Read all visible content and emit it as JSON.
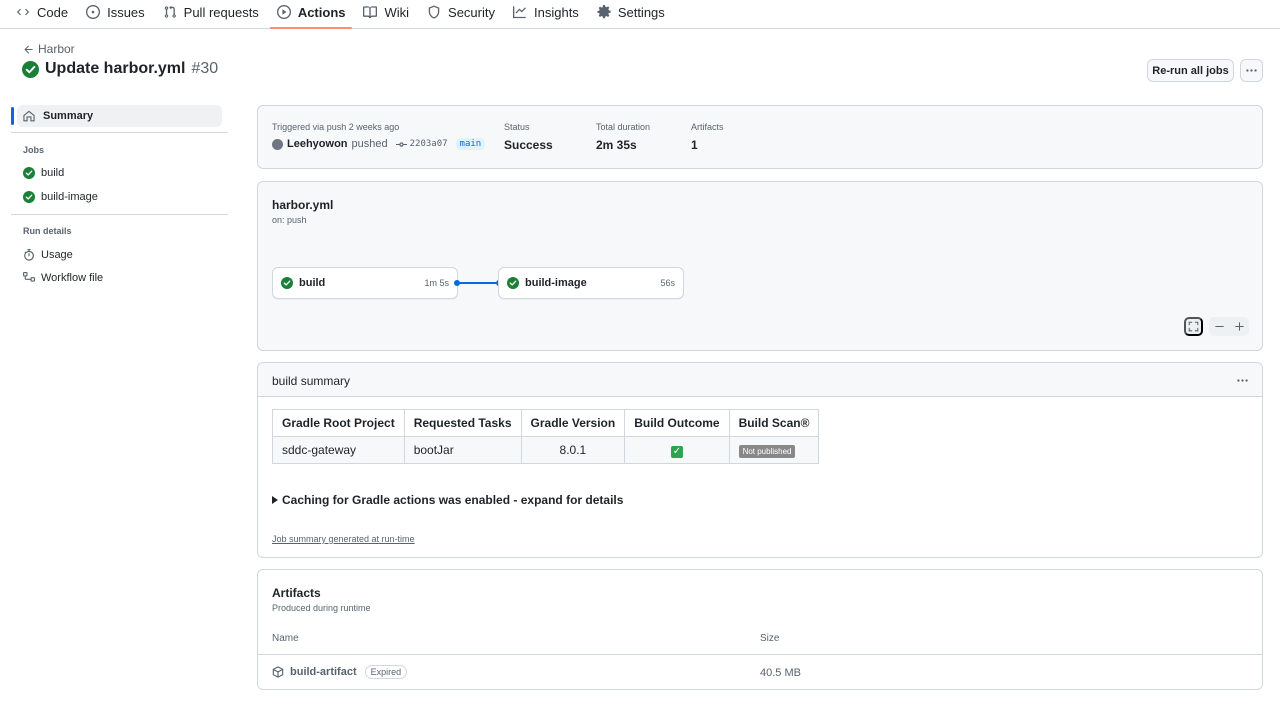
{
  "nav": {
    "tabs": [
      {
        "label": "Code",
        "icon": "code-icon"
      },
      {
        "label": "Issues",
        "icon": "issue-icon"
      },
      {
        "label": "Pull requests",
        "icon": "pull-request-icon"
      },
      {
        "label": "Actions",
        "icon": "play-icon",
        "active": true
      },
      {
        "label": "Wiki",
        "icon": "book-icon"
      },
      {
        "label": "Security",
        "icon": "shield-icon"
      },
      {
        "label": "Insights",
        "icon": "graph-icon"
      },
      {
        "label": "Settings",
        "icon": "gear-icon"
      }
    ]
  },
  "header": {
    "back_label": "Harbor",
    "title": "Update harbor.yml",
    "run_number": "#30",
    "rerun_label": "Re-run all jobs"
  },
  "sidebar": {
    "summary_label": "Summary",
    "jobs_heading": "Jobs",
    "jobs": [
      {
        "label": "build"
      },
      {
        "label": "build-image"
      }
    ],
    "run_details_heading": "Run details",
    "details": [
      {
        "label": "Usage",
        "icon": "stopwatch-icon"
      },
      {
        "label": "Workflow file",
        "icon": "workflow-icon"
      }
    ]
  },
  "run_info": {
    "trigger_label": "Triggered via push 2 weeks ago",
    "actor": "Leehyowon",
    "action": "pushed",
    "commit": "2203a07",
    "branch": "main",
    "status_label": "Status",
    "status_value": "Success",
    "duration_label": "Total duration",
    "duration_value": "2m 35s",
    "artifacts_label": "Artifacts",
    "artifacts_value": "1"
  },
  "workflow": {
    "name": "harbor.yml",
    "trigger": "on: push",
    "jobs": [
      {
        "name": "build",
        "duration": "1m 5s"
      },
      {
        "name": "build-image",
        "duration": "56s"
      }
    ]
  },
  "build_summary": {
    "title": "build summary",
    "columns": [
      "Gradle Root Project",
      "Requested Tasks",
      "Gradle Version",
      "Build Outcome",
      "Build Scan®"
    ],
    "row": {
      "project": "sddc-gateway",
      "tasks": "bootJar",
      "version": "8.0.1",
      "outcome": "✓",
      "scan": "Not published"
    },
    "caching_text": "Caching for Gradle actions was enabled - expand for details",
    "footer_link": "Job summary generated at run-time"
  },
  "artifacts": {
    "title": "Artifacts",
    "subtitle": "Produced during runtime",
    "name_header": "Name",
    "size_header": "Size",
    "items": [
      {
        "name": "build-artifact",
        "badge": "Expired",
        "size": "40.5 MB"
      }
    ]
  },
  "colors": {
    "accent": "#0969da",
    "success": "#1a7f37",
    "tab_underline": "#fd8c73"
  }
}
